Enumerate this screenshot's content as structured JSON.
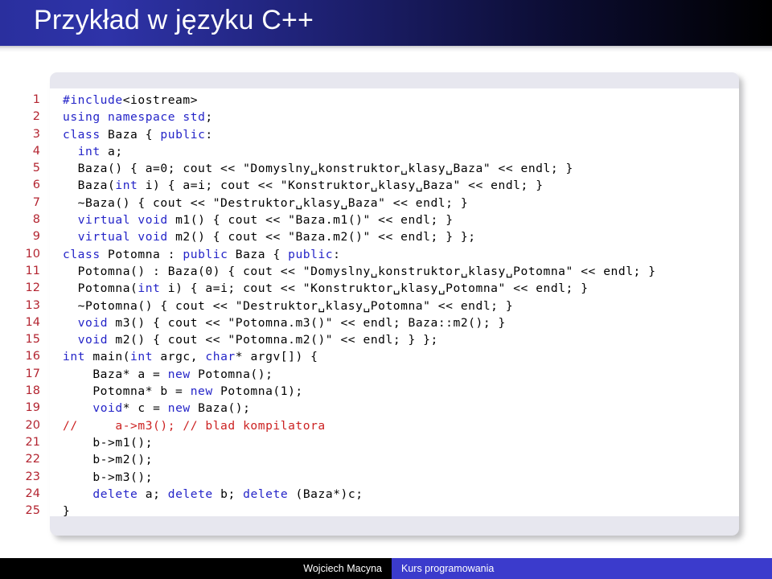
{
  "slide": {
    "title": "Przykład w języku C++",
    "header_gradient_from": "#2a2f9e",
    "header_gradient_to": "#000000"
  },
  "code": {
    "language": "C++",
    "keyword_color": "#2424c8",
    "comment_color": "#cc2222",
    "lineno_color": "#b32430",
    "text_color": "#000000",
    "lines": [
      {
        "n": "1",
        "text": "#include<iostream>"
      },
      {
        "n": "2",
        "text": "using namespace std;"
      },
      {
        "n": "3",
        "text": "class Baza { public:"
      },
      {
        "n": "4",
        "text": "  int a;"
      },
      {
        "n": "5",
        "text": "  Baza() { a=0; cout << \"Domyslny␣konstruktor␣klasy␣Baza\" << endl; }"
      },
      {
        "n": "6",
        "text": "  Baza(int i) { a=i; cout << \"Konstruktor␣klasy␣Baza\" << endl; }"
      },
      {
        "n": "7",
        "text": "  ~Baza() { cout << \"Destruktor␣klasy␣Baza\" << endl; }"
      },
      {
        "n": "8",
        "text": "  virtual void m1() { cout << \"Baza.m1()\" << endl; }"
      },
      {
        "n": "9",
        "text": "  virtual void m2() { cout << \"Baza.m2()\" << endl; } };"
      },
      {
        "n": "10",
        "text": "class Potomna : public Baza { public:"
      },
      {
        "n": "11",
        "text": "  Potomna() : Baza(0) { cout << \"Domyslny␣konstruktor␣klasy␣Potomna\" << endl; }"
      },
      {
        "n": "12",
        "text": "  Potomna(int i) { a=i; cout << \"Konstruktor␣klasy␣Potomna\" << endl; }"
      },
      {
        "n": "13",
        "text": "  ~Potomna() { cout << \"Destruktor␣klasy␣Potomna\" << endl; }"
      },
      {
        "n": "14",
        "text": "  void m3() { cout << \"Potomna.m3()\" << endl; Baza::m2(); }"
      },
      {
        "n": "15",
        "text": "  void m2() { cout << \"Potomna.m2()\" << endl; } };"
      },
      {
        "n": "16",
        "text": "int main(int argc, char* argv[]) {"
      },
      {
        "n": "17",
        "text": "    Baza* a = new Potomna();"
      },
      {
        "n": "18",
        "text": "    Potomna* b = new Potomna(1);"
      },
      {
        "n": "19",
        "text": "    void* c = new Baza();"
      },
      {
        "n": "20",
        "text": "//     a->m3(); // blad kompilatora"
      },
      {
        "n": "21",
        "text": "    b->m1();"
      },
      {
        "n": "22",
        "text": "    b->m2();"
      },
      {
        "n": "23",
        "text": "    b->m3();"
      },
      {
        "n": "24",
        "text": "    delete a; delete b; delete (Baza*)c;"
      },
      {
        "n": "25",
        "text": "}"
      }
    ]
  },
  "footer": {
    "author": "Wojciech Macyna",
    "course": "Kurs programowania",
    "left_bg": "#000000",
    "right_bg": "#3b3bcc"
  }
}
